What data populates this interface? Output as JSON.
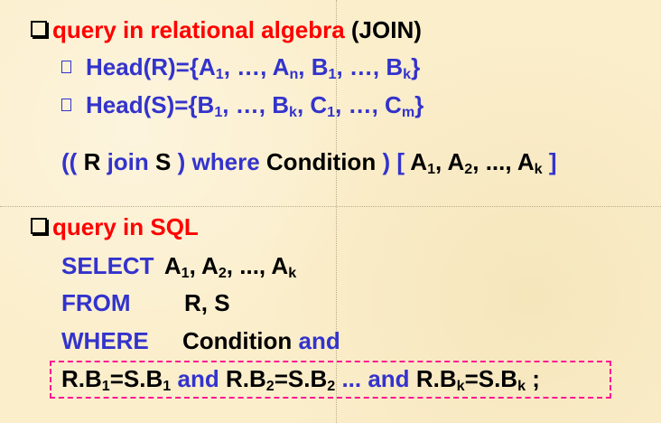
{
  "section1": {
    "heading_red": "query in relational algebra",
    "heading_black": "(JOIN)",
    "head_r": {
      "prefix": "Head(R)={A",
      "s1": "1",
      "m1": ", …, A",
      "s2": "n",
      "m2": ", B",
      "s3": "1",
      "m3": ", …, B",
      "s4": "k",
      "end": "}"
    },
    "head_s": {
      "prefix": "Head(S)={B",
      "s1": "1",
      "m1": ", …, B",
      "s2": "k",
      "m2": ", C",
      "s3": "1",
      "m3": ", …, C",
      "s4": "m",
      "end": "}"
    },
    "expr": {
      "p1": "((",
      "r": "R",
      "join": "join",
      "s": "S",
      "p2": ")",
      "where": "where",
      "cond": "Condition",
      "p3": ")",
      "lb": "[",
      "a1": "A",
      "a1s": "1",
      "comma1": ", A",
      "a2s": "2",
      "ell": ", ..., A",
      "aks": "k",
      "rb": "]"
    }
  },
  "section2": {
    "heading_red": "query in SQL",
    "select_kw": "SELECT",
    "select_a": "A",
    "select_s1": "1",
    "select_m": ", A",
    "select_s2": "2",
    "select_e": ", ..., A",
    "select_sk": "k",
    "from_kw": "FROM",
    "from_val": "R, S",
    "where_kw": "WHERE",
    "where_val": "Condition",
    "and_kw": "and",
    "boxed": {
      "t1": "R.B",
      "s1": "1",
      "t2": "=S.B",
      "s2": "1",
      "and1": "and",
      "t3": "R.B",
      "s3": "2",
      "t4": "=S.B",
      "s4": "2",
      "dots": "...",
      "and2": "and",
      "t5": "R.B",
      "s5": "k",
      "t6": "=S.B",
      "s6": "k",
      "semi": ";"
    }
  },
  "colors": {
    "red": "#ff0000",
    "blue": "#3333cc",
    "black": "#000000",
    "dash": "#ff1493",
    "background": "#fbeecb"
  }
}
